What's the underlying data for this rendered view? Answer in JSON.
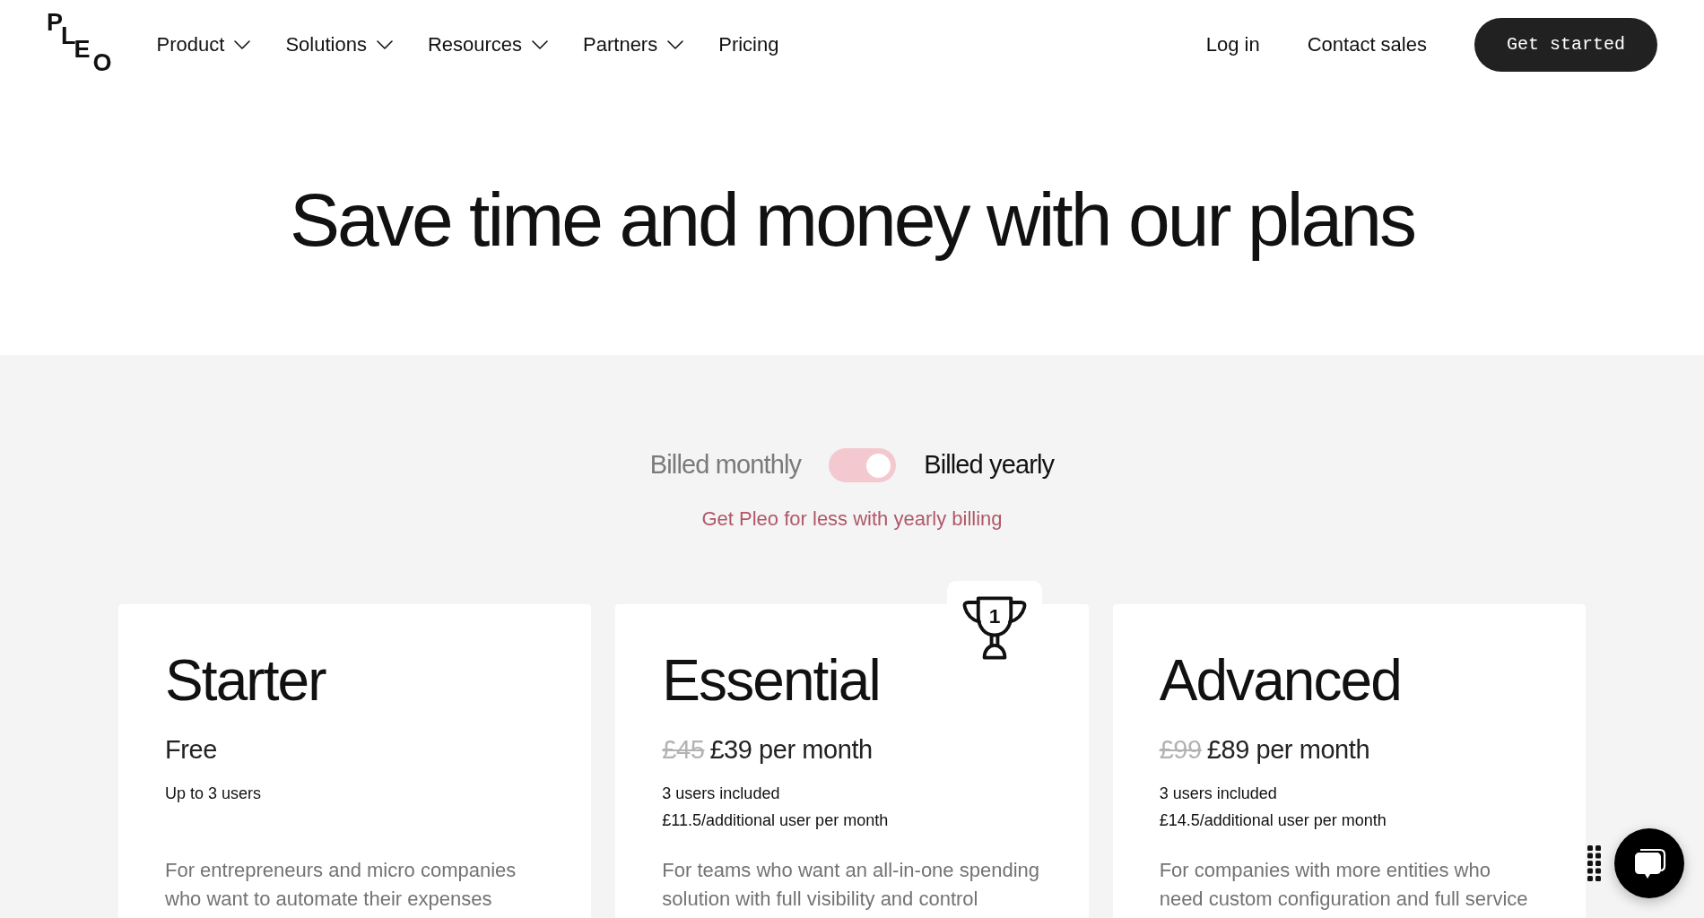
{
  "header": {
    "logo": "PLEO",
    "nav": [
      {
        "label": "Product",
        "kind": "menu"
      },
      {
        "label": "Solutions",
        "kind": "menu"
      },
      {
        "label": "Resources",
        "kind": "menu"
      },
      {
        "label": "Partners",
        "kind": "menu"
      },
      {
        "label": "Pricing",
        "kind": "link"
      }
    ],
    "login": "Log in",
    "contact": "Contact sales",
    "cta": "Get started"
  },
  "hero": {
    "title": "Save time and money with our plans"
  },
  "billing": {
    "monthly_label": "Billed monthly",
    "yearly_label": "Billed yearly",
    "yearly": true,
    "note": "Get Pleo for less with yearly billing"
  },
  "plans": [
    {
      "name": "Starter",
      "price": "Free",
      "details": [
        "Up to 3 users"
      ],
      "description": [
        "For entrepreneurs and micro companies",
        "who want to automate their expenses"
      ],
      "featured": false
    },
    {
      "name": "Essential",
      "old_price": "£45",
      "price": "£39 per month",
      "details": [
        "3 users included",
        "£11.5/additional user per month"
      ],
      "description": [
        "For teams who want an all-in-one spending",
        "solution with full visibility and control"
      ],
      "featured": true,
      "rank": "1"
    },
    {
      "name": "Advanced",
      "old_price": "£99",
      "price": "£89 per month",
      "details": [
        "3 users included",
        "£14.5/additional user per month"
      ],
      "description": [
        "For companies with more entities who",
        "need custom configuration and full service"
      ],
      "featured": false
    }
  ]
}
